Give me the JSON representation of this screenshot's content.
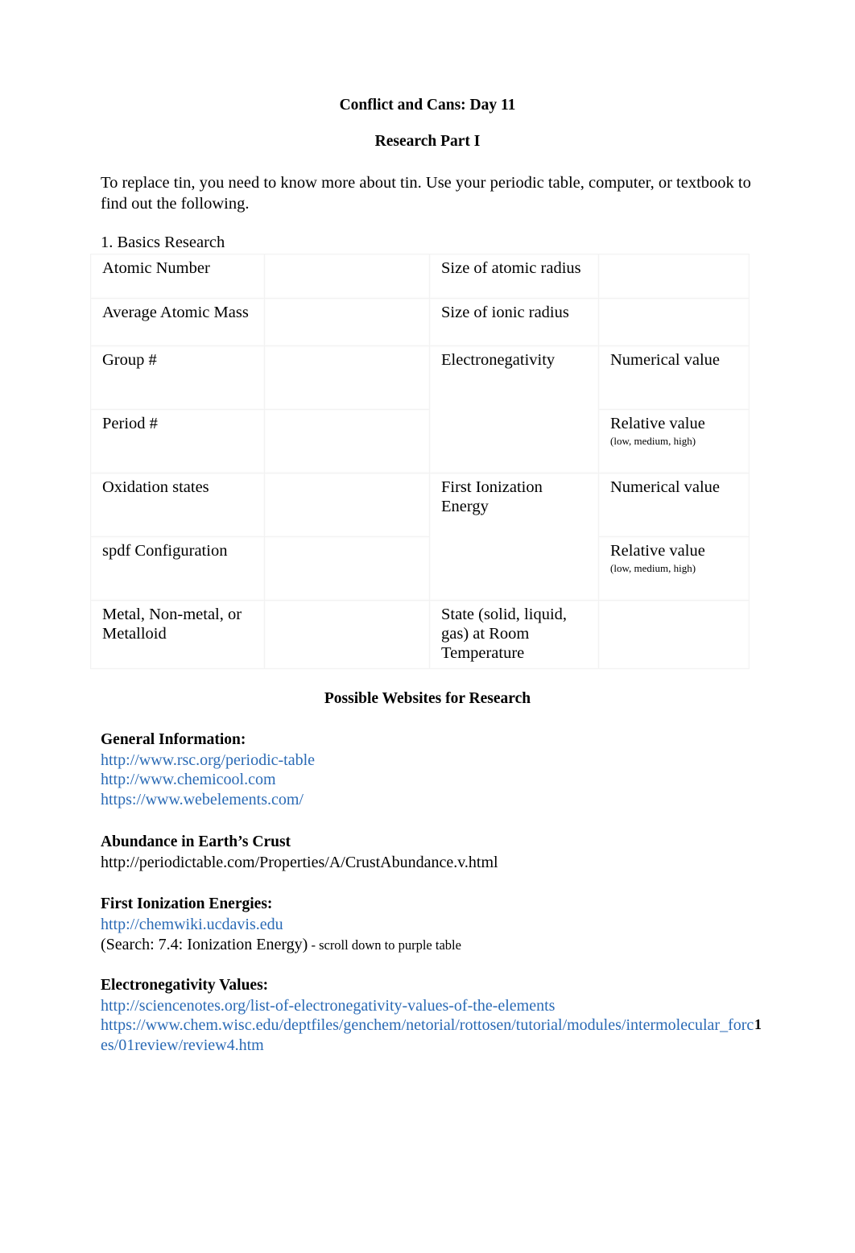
{
  "document": {
    "title": "Conflict and Cans: Day 11",
    "subtitle": "Research Part I",
    "intro": "To replace tin, you need to know more about tin.  Use your periodic table, computer, or textbook to find out the following.",
    "section_label": "1. Basics Research",
    "page_number": "1"
  },
  "table": {
    "rows": [
      {
        "left_label": "Atomic Number",
        "left_value": "",
        "right_label": "Size of atomic radius",
        "right_value": ""
      },
      {
        "left_label": "Average Atomic Mass",
        "left_value": "",
        "right_label": "Size of ionic radius",
        "right_value": ""
      },
      {
        "left_label": "Group #",
        "left_value": "",
        "right_label": "Electronegativity",
        "right_value": "Numerical value"
      },
      {
        "left_label": "Period #",
        "left_value": "",
        "right_value_main": "Relative value",
        "right_value_note": "(low, medium, high)"
      },
      {
        "left_label": "Oxidation states",
        "left_value": "",
        "right_label": "First Ionization Energy",
        "right_value": "Numerical value"
      },
      {
        "left_label": "spdf Configuration",
        "left_value": "",
        "right_value_main": "Relative value",
        "right_value_note": "(low, medium, high)"
      },
      {
        "left_label": "Metal, Non-metal, or Metalloid",
        "left_value": "",
        "right_label": "State (solid, liquid, gas) at Room Temperature",
        "right_value": ""
      }
    ]
  },
  "websites": {
    "heading": "Possible Websites for Research",
    "groups": [
      {
        "heading": "General Information:",
        "links": [
          {
            "text": "http://www.rsc.org/periodic-table",
            "style": "blue"
          },
          {
            "text": "http://www.chemicool.com",
            "style": "blue"
          },
          {
            "text": "https://www.webelements.com/",
            "style": "blue"
          }
        ]
      },
      {
        "heading": "Abundance in Earth’s Crust",
        "links": [
          {
            "text": "http://periodictable.com/Properties/A/CrustAbundance.v.html",
            "style": "plain"
          }
        ]
      },
      {
        "heading": "First Ionization Energies:",
        "links": [
          {
            "text": "http://chemwiki.ucdavis.edu",
            "style": "blue"
          }
        ],
        "note": "(Search: 7.4: Ionization Energy)",
        "note_small": " - scroll down to purple table"
      },
      {
        "heading": "Electronegativity Values:",
        "links": [
          {
            "text": "http://sciencenotes.org/list-of-electronegativity-values-of-the-elements",
            "style": "blue"
          },
          {
            "text": "https://www.chem.wisc.edu/deptfiles/genchem/netorial/rottosen/tutorial/modules/intermolecular_forces/01review/review4.htm",
            "style": "blue"
          }
        ]
      }
    ]
  },
  "colors": {
    "link": "#2a6ab5",
    "text": "#000000",
    "table_border": "#f2f2f2",
    "page_background": "#ffffff"
  }
}
